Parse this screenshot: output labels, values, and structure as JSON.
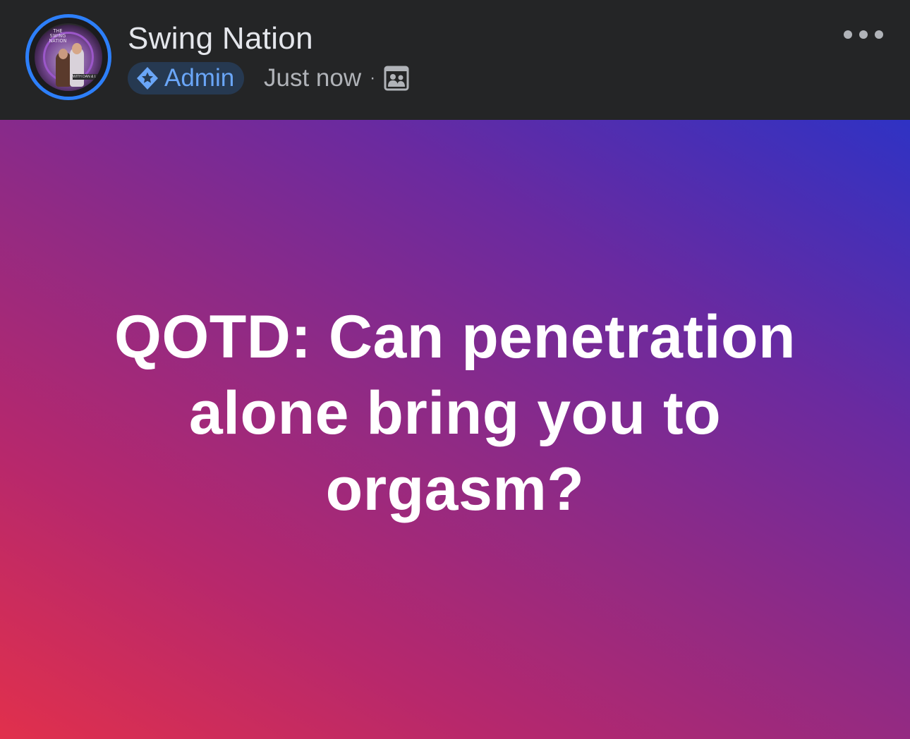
{
  "post": {
    "page_name": "Swing Nation",
    "avatar_text": {
      "top": "THE SWING NATION",
      "bottom": "WITH DAN & LACY"
    },
    "badge": {
      "label": "Admin",
      "icon": "admin-star-shield-icon"
    },
    "timestamp": "Just now",
    "separator": "·",
    "audience_icon": "group-members-icon",
    "more_icon": "more-options-icon",
    "body_text": "QOTD: Can penetration alone bring you to orgasm?",
    "background_colors": [
      "#e1304c",
      "#b7286c",
      "#8e2a86",
      "#6a2aa0",
      "#2f32c4"
    ]
  },
  "colors": {
    "header_bg": "#242526",
    "name_text": "#e4e6eb",
    "meta_text": "#b0b3b8",
    "admin_badge_bg": "#263951",
    "admin_badge_text": "#6aa6f8",
    "avatar_ring": "#2d7ff9",
    "body_text": "#ffffff"
  }
}
